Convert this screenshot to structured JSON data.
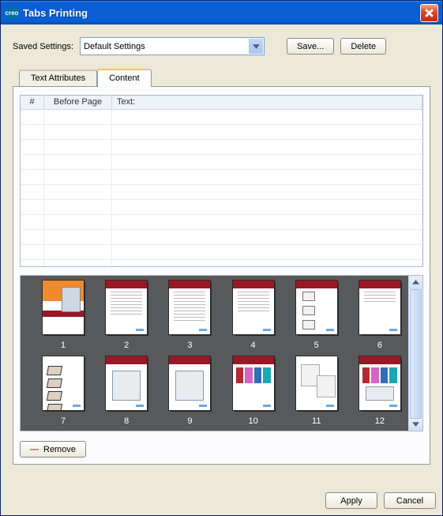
{
  "window": {
    "title": "Tabs Printing",
    "logo_text": "creo"
  },
  "savedSettings": {
    "label": "Saved Settings:",
    "value": "Default Settings",
    "saveBtn": "Save...",
    "deleteBtn": "Delete"
  },
  "tabs": {
    "textAttributes": "Text Attributes",
    "content": "Content"
  },
  "grid": {
    "headers": {
      "num": "#",
      "before": "Before Page",
      "text": "Text:"
    }
  },
  "thumbnails": {
    "labels": [
      "1",
      "2",
      "3",
      "4",
      "5",
      "6",
      "7",
      "8",
      "9",
      "10",
      "11",
      "12"
    ]
  },
  "removeBtn": "Remove",
  "footer": {
    "apply": "Apply",
    "cancel": "Cancel"
  }
}
